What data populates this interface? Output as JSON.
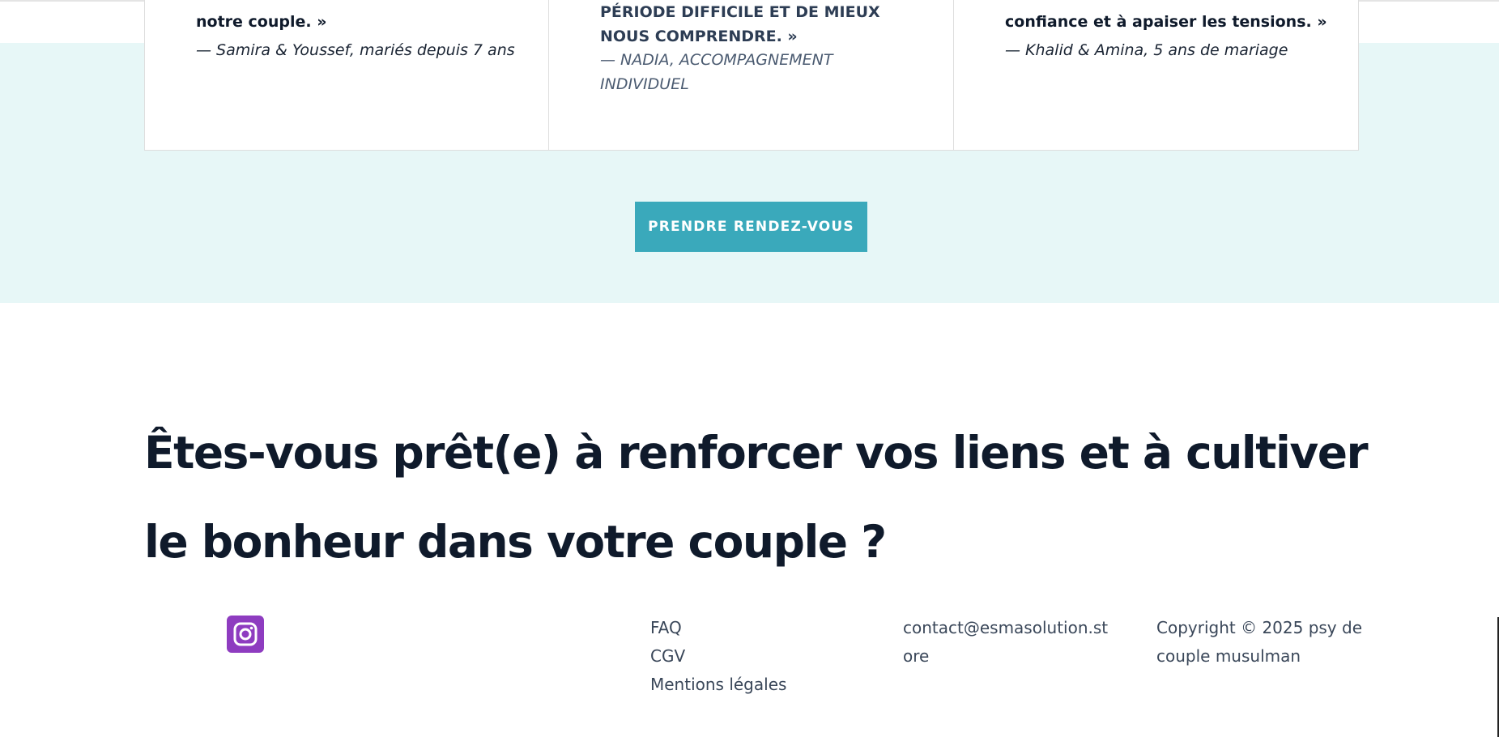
{
  "testimonials": [
    {
      "quote": "notre couple. »",
      "author": "— Samira & Youssef, mariés depuis 7 ans"
    },
    {
      "quote": "période difficile et de mieux nous comprendre. »",
      "author": "— Nadia, accompagnement individuel"
    },
    {
      "quote": "confiance et à apaiser les tensions. »",
      "author": "— Khalid & Amina, 5 ans de mariage"
    }
  ],
  "cta": {
    "label": "PRENDRE RENDEZ-VOUS"
  },
  "headline": "Êtes-vous prêt(e) à renforcer vos liens et à cultiver le bonheur dans votre couple ?",
  "footer": {
    "social": {
      "icon": "instagram-icon",
      "color": "#8e3cc0"
    },
    "links": [
      "FAQ",
      "CGV",
      "Mentions légales"
    ],
    "contact_email": "contact@esmasolution.store",
    "copyright": "Copyright © 2025 psy de couple musulman"
  },
  "colors": {
    "accent": "#3aa9bb",
    "band_background": "#e7f7f7",
    "text_dark": "#0f1a2b"
  }
}
